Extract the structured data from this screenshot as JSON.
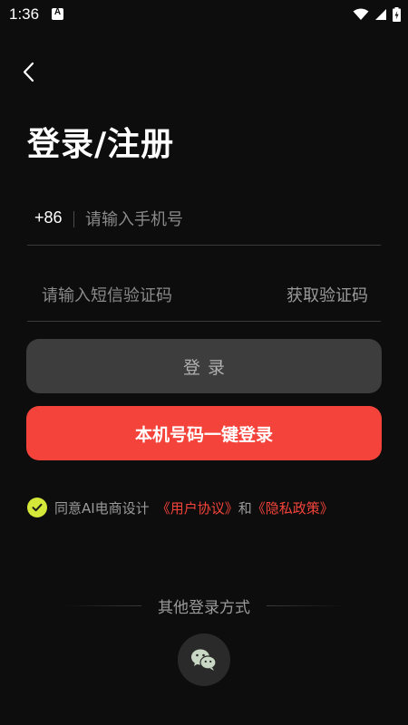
{
  "status_bar": {
    "time": "1:36",
    "notification_icon_letter": "A",
    "icons": [
      "wifi-icon",
      "signal-icon",
      "battery-icon"
    ]
  },
  "header": {
    "back_icon": "chevron-left-icon",
    "title": "登录/注册"
  },
  "form": {
    "country_code": "+86",
    "phone_placeholder": "请输入手机号",
    "phone_value": "",
    "code_placeholder": "请输入短信验证码",
    "code_value": "",
    "get_code_label": "获取验证码",
    "login_label": "登录",
    "one_key_login_label": "本机号码一键登录"
  },
  "agreement": {
    "checked": true,
    "prefix": "同意AI电商设计",
    "user_agreement": "《用户协议》",
    "and": "和",
    "privacy_policy": "《隐私政策》"
  },
  "other_login": {
    "label": "其他登录方式",
    "wechat_icon": "wechat-icon"
  },
  "colors": {
    "background": "#0d0d0d",
    "accent_red": "#f4433a",
    "check_green": "#d4e83a",
    "disabled_button": "#3d3d3d"
  }
}
